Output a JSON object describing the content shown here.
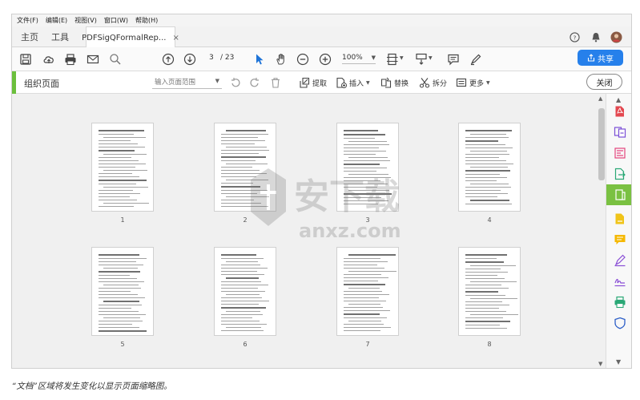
{
  "menubar": [
    "文件(F)",
    "编辑(E)",
    "视图(V)",
    "窗口(W)",
    "帮助(H)"
  ],
  "tabs": {
    "home": "主页",
    "tools": "工具",
    "doc": "PDFSigQFormalRep...",
    "close_glyph": "×"
  },
  "toolbar": {
    "page_current": "3",
    "page_total": "/ 23",
    "zoom": "100%"
  },
  "share_label": "共享",
  "organize": {
    "title": "组织页面",
    "range_placeholder": "输入页面范围",
    "extract": "提取",
    "insert": "插入",
    "replace": "替换",
    "split": "拆分",
    "more": "更多",
    "close": "关闭"
  },
  "pages": [
    {
      "num": "1"
    },
    {
      "num": "2"
    },
    {
      "num": "3"
    },
    {
      "num": "4"
    },
    {
      "num": "5"
    },
    {
      "num": "6"
    },
    {
      "num": "7"
    },
    {
      "num": "8"
    }
  ],
  "watermark": {
    "text": "安下载",
    "url": "anxz.com"
  },
  "caption": "“文档”区域将发生变化以显示页面缩略图。",
  "colors": {
    "accent_green": "#6bbf3c",
    "share_blue": "#2680eb",
    "panel_active": "#7ac142"
  }
}
